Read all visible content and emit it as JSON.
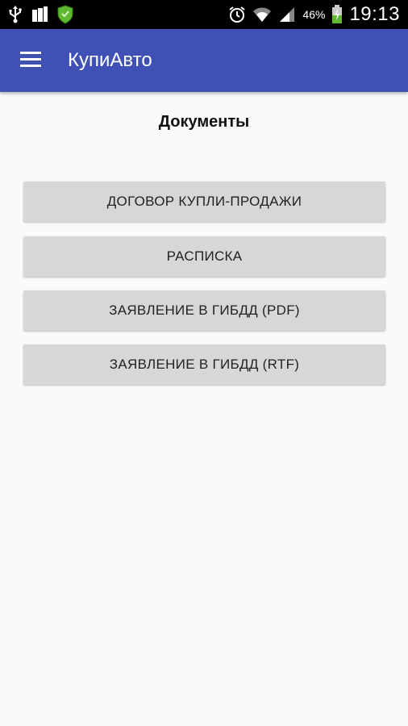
{
  "status_bar": {
    "battery_percent": "46%",
    "time": "19:13",
    "icons": [
      "usb-icon",
      "storage-icon",
      "shield-icon",
      "alarm-icon",
      "wifi-icon",
      "signal-icon",
      "battery-charging-icon"
    ]
  },
  "app_bar": {
    "title": "КупиАвто",
    "color": "#3f51b5",
    "menu_icon": "menu-icon"
  },
  "main": {
    "title": "Документы",
    "buttons": [
      {
        "label": "ДОГОВОР КУПЛИ-ПРОДАЖИ"
      },
      {
        "label": "РАСПИСКА"
      },
      {
        "label": "ЗАЯВЛЕНИЕ В ГИБДД (PDF)"
      },
      {
        "label": "ЗАЯВЛЕНИЕ В ГИБДД (RTF)"
      }
    ]
  }
}
